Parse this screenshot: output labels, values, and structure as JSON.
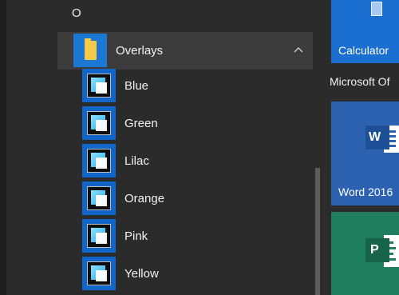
{
  "start_menu": {
    "header_letter": "O",
    "group": {
      "label": "Overlays",
      "icon": "folder-icon",
      "expanded": true,
      "chevron": "chevron-up-icon"
    },
    "items": [
      {
        "label": "Blue"
      },
      {
        "label": "Green"
      },
      {
        "label": "Lilac"
      },
      {
        "label": "Orange"
      },
      {
        "label": "Pink"
      },
      {
        "label": "Yellow"
      }
    ]
  },
  "tiles": {
    "calculator": {
      "label": "Calculator",
      "icon": "calculator-icon",
      "color": "#1a6fd0"
    },
    "section_label": "Microsoft Of",
    "word": {
      "label": "Word 2016",
      "icon": "word-icon",
      "color": "#2c62b0"
    },
    "project": {
      "label": "",
      "icon": "project-icon",
      "color": "#1f7e5f"
    }
  },
  "colors": {
    "background": "#2b2b2b",
    "group_row": "#3c3c3c",
    "accent": "#1c78d3",
    "folder": "#f7c948"
  }
}
